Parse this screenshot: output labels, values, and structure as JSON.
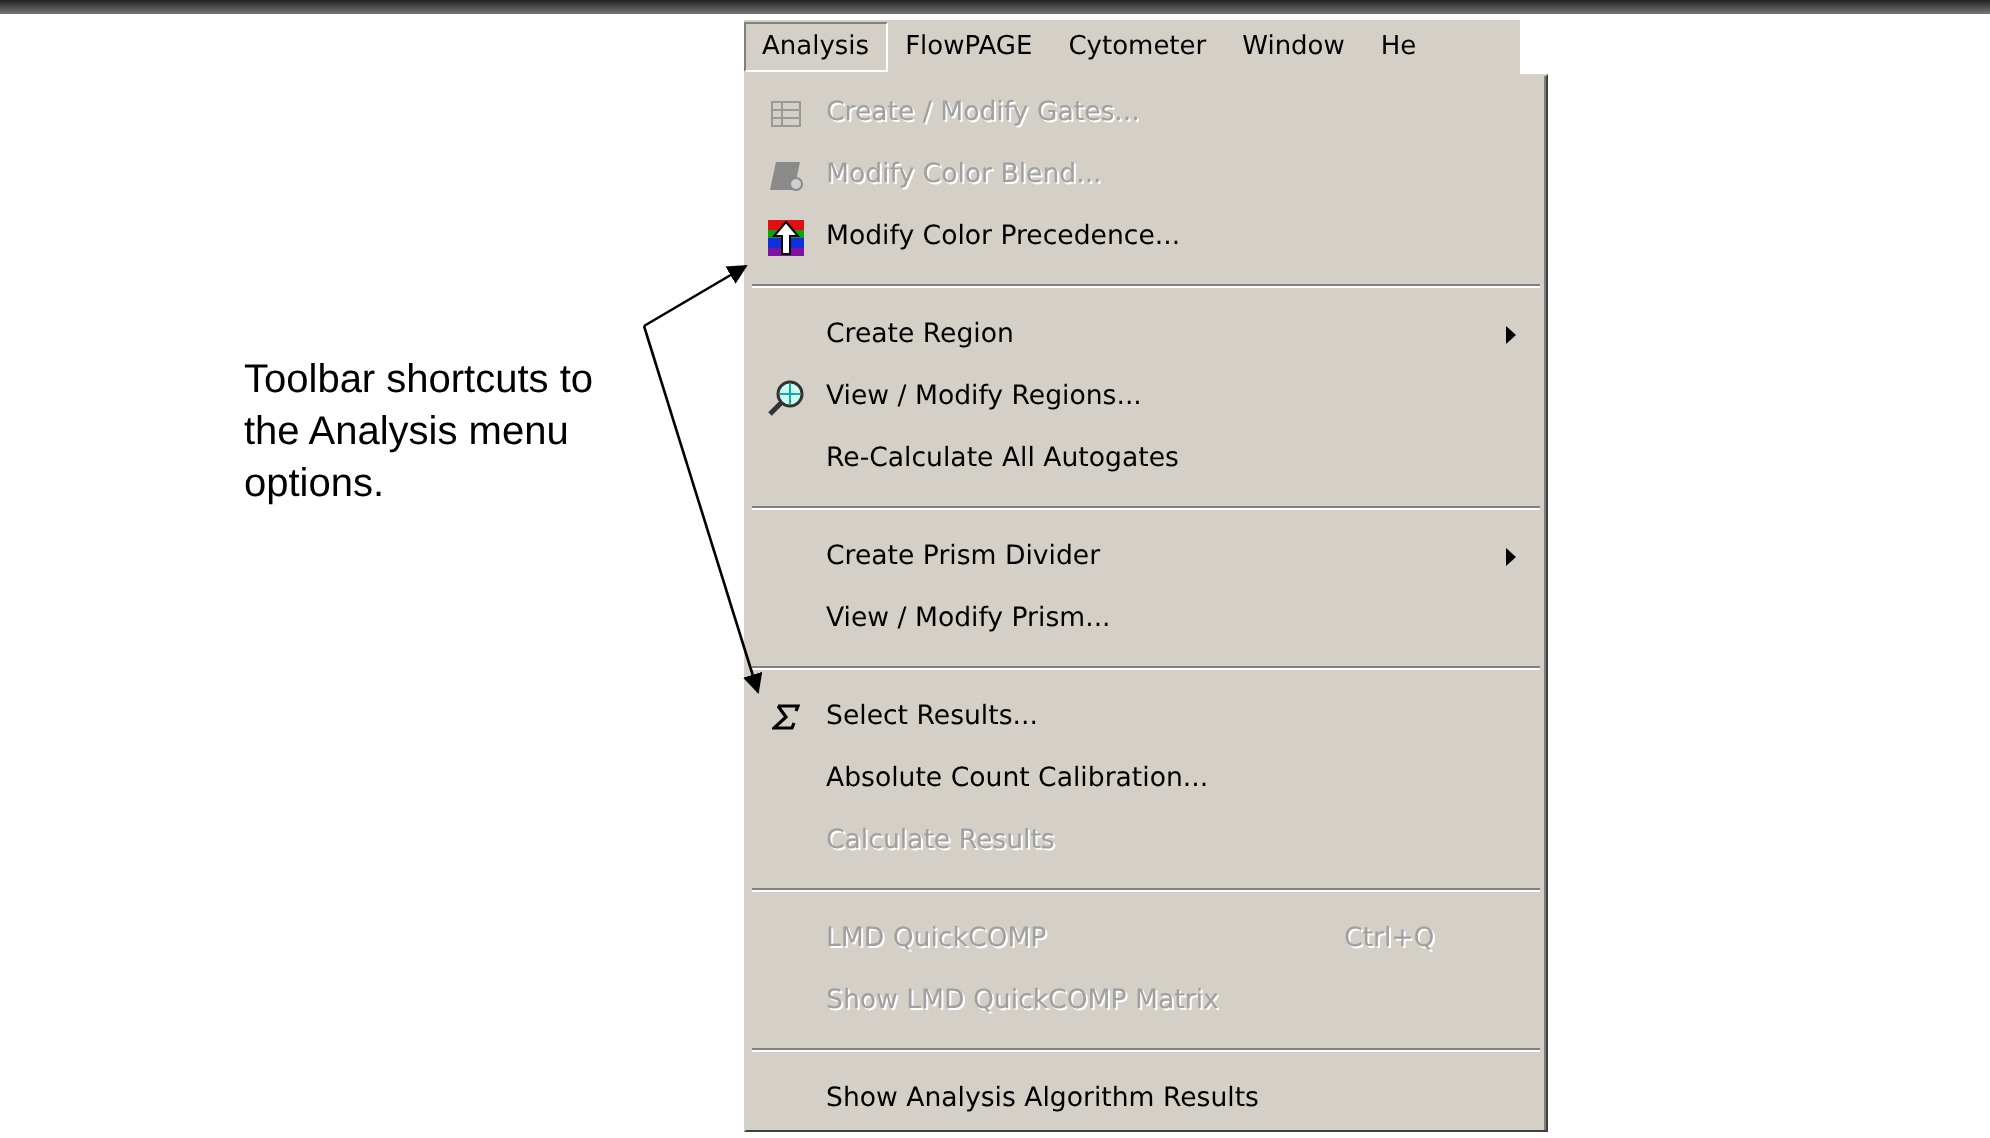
{
  "annotation": "Toolbar shortcuts to the Analysis menu options.",
  "menubar": [
    {
      "label": "Analysis",
      "selected": true
    },
    {
      "label": "FlowPAGE",
      "selected": false
    },
    {
      "label": "Cytometer",
      "selected": false
    },
    {
      "label": "Window",
      "selected": false
    },
    {
      "label": "He",
      "selected": false
    }
  ],
  "menu": [
    {
      "kind": "item",
      "label": "Create / Modify Gates...",
      "disabled": true,
      "icon": true,
      "submenu": false
    },
    {
      "kind": "item",
      "label": "Modify Color Blend...",
      "disabled": true,
      "icon": true,
      "submenu": false
    },
    {
      "kind": "item",
      "label": "Modify Color Precedence...",
      "disabled": false,
      "icon": true,
      "submenu": false
    },
    {
      "kind": "separator"
    },
    {
      "kind": "item",
      "label": "Create Region",
      "disabled": false,
      "icon": false,
      "submenu": true
    },
    {
      "kind": "item",
      "label": "View / Modify Regions...",
      "disabled": false,
      "icon": true,
      "submenu": false
    },
    {
      "kind": "item",
      "label": "Re-Calculate All Autogates",
      "disabled": false,
      "icon": false,
      "submenu": false
    },
    {
      "kind": "separator"
    },
    {
      "kind": "item",
      "label": "Create Prism Divider",
      "disabled": false,
      "icon": false,
      "submenu": true
    },
    {
      "kind": "item",
      "label": "View / Modify Prism...",
      "disabled": false,
      "icon": false,
      "submenu": false
    },
    {
      "kind": "separator"
    },
    {
      "kind": "item",
      "label": "Select Results...",
      "disabled": false,
      "icon": true,
      "submenu": false
    },
    {
      "kind": "item",
      "label": "Absolute Count Calibration...",
      "disabled": false,
      "icon": false,
      "submenu": false
    },
    {
      "kind": "item",
      "label": "Calculate Results",
      "disabled": true,
      "icon": false,
      "submenu": false
    },
    {
      "kind": "separator"
    },
    {
      "kind": "item",
      "label": "LMD QuickCOMP",
      "disabled": true,
      "icon": false,
      "submenu": false,
      "shortcut": "Ctrl+Q"
    },
    {
      "kind": "item",
      "label": "Show LMD QuickCOMP Matrix",
      "disabled": true,
      "icon": false,
      "submenu": false
    },
    {
      "kind": "separator"
    },
    {
      "kind": "item",
      "label": "Show Analysis Algorithm Results",
      "disabled": false,
      "icon": false,
      "submenu": false
    }
  ]
}
